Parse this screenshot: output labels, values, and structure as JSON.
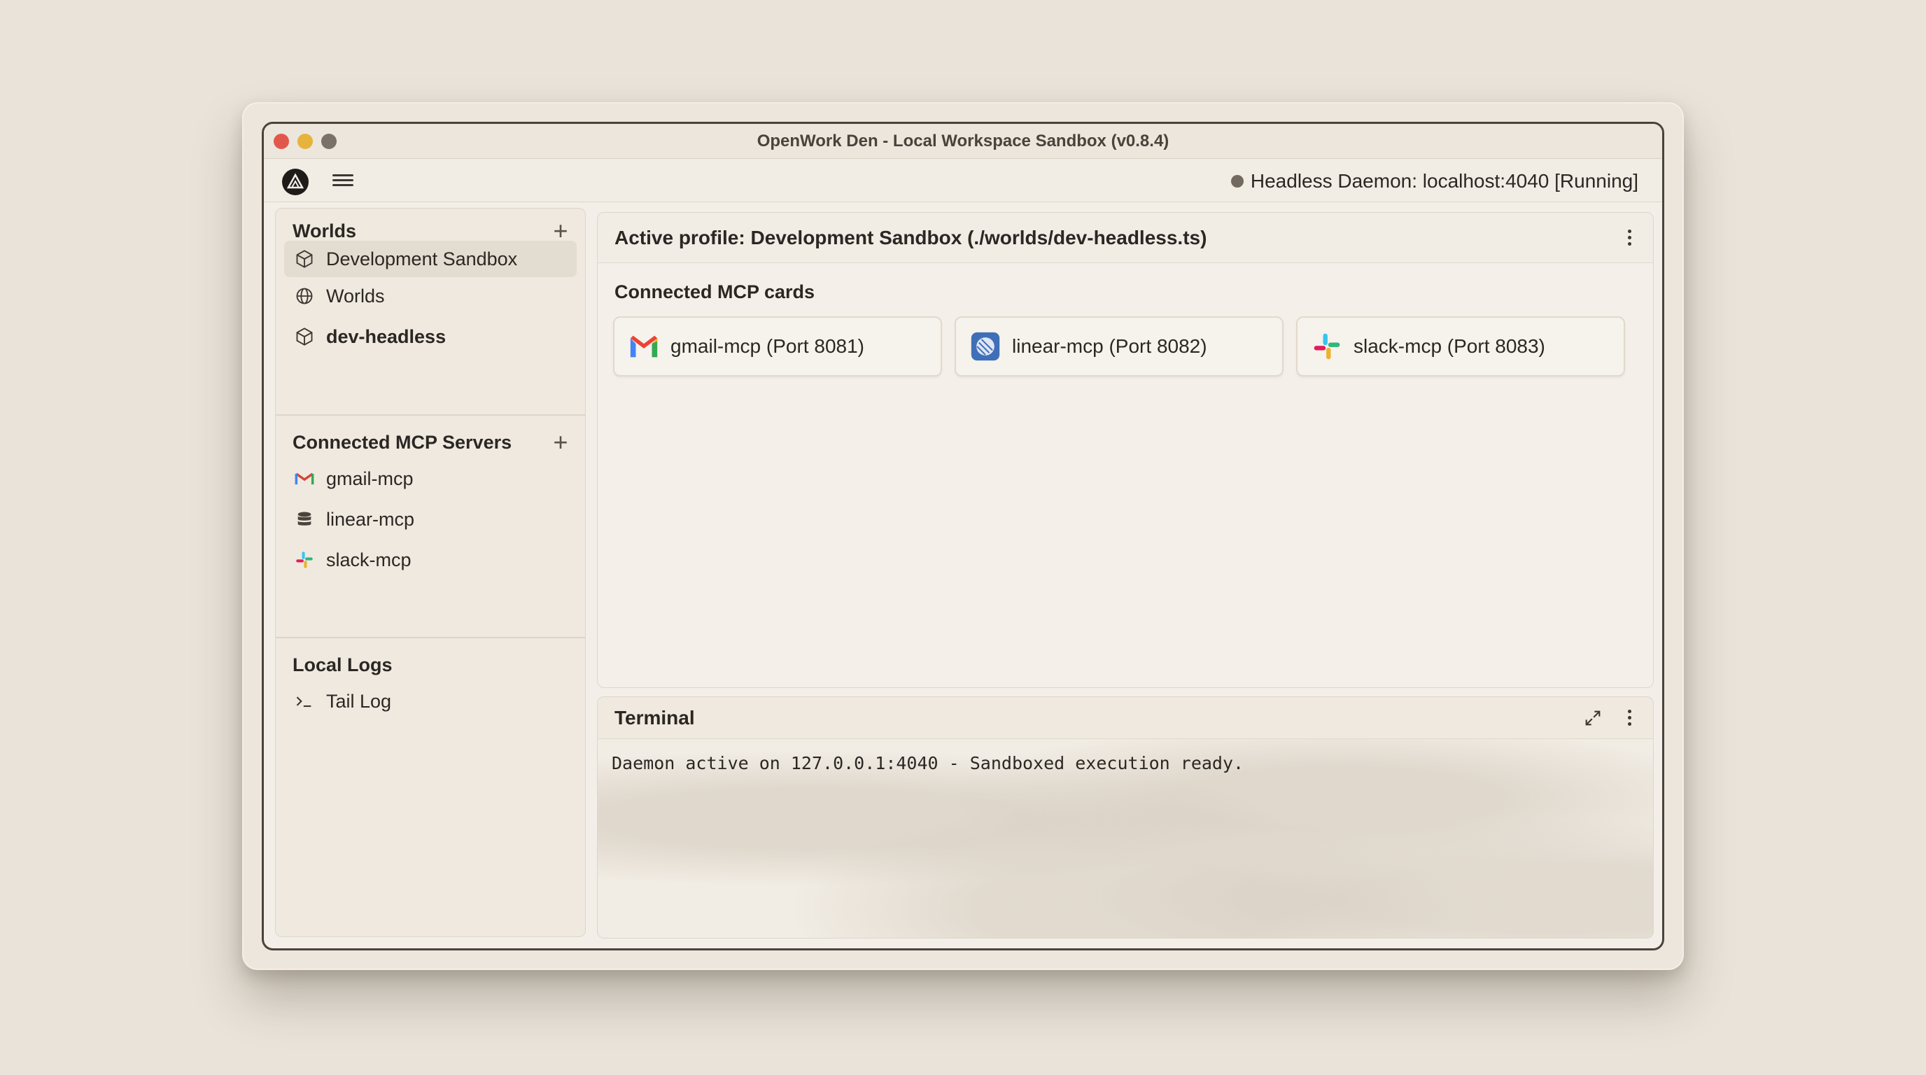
{
  "window": {
    "title": "OpenWork Den - Local Workspace Sandbox (v0.8.4)"
  },
  "toolbar": {
    "daemon_status": "Headless Daemon: localhost:4040 [Running]"
  },
  "sidebar": {
    "worlds_heading": "Worlds",
    "worlds_items": [
      {
        "label": "Development Sandbox",
        "icon": "cube-icon",
        "active": true
      },
      {
        "label": "Worlds",
        "icon": "globe-icon"
      },
      {
        "label": "dev-headless",
        "icon": "cube-icon"
      }
    ],
    "mcp_heading": "Connected MCP Servers",
    "mcp_items": [
      {
        "label": "gmail-mcp",
        "icon": "gmail-icon"
      },
      {
        "label": "linear-mcp",
        "icon": "database-icon"
      },
      {
        "label": "slack-mcp",
        "icon": "slack-icon"
      }
    ],
    "logs_heading": "Local Logs",
    "logs_items": [
      {
        "label": "Tail Log",
        "icon": "terminal-prompt-icon"
      }
    ]
  },
  "main": {
    "profile_title": "Active profile: Development Sandbox (./worlds/dev-headless.ts)",
    "cards_title": "Connected MCP cards",
    "cards": [
      {
        "label": "gmail-mcp (Port 8081)",
        "icon": "gmail-icon"
      },
      {
        "label": "linear-mcp (Port 8082)",
        "icon": "linear-icon"
      },
      {
        "label": "slack-mcp (Port 8083)",
        "icon": "slack-icon"
      }
    ]
  },
  "terminal": {
    "title": "Terminal",
    "line": "Daemon active on 127.0.0.1:4040 - Sandboxed execution ready."
  }
}
